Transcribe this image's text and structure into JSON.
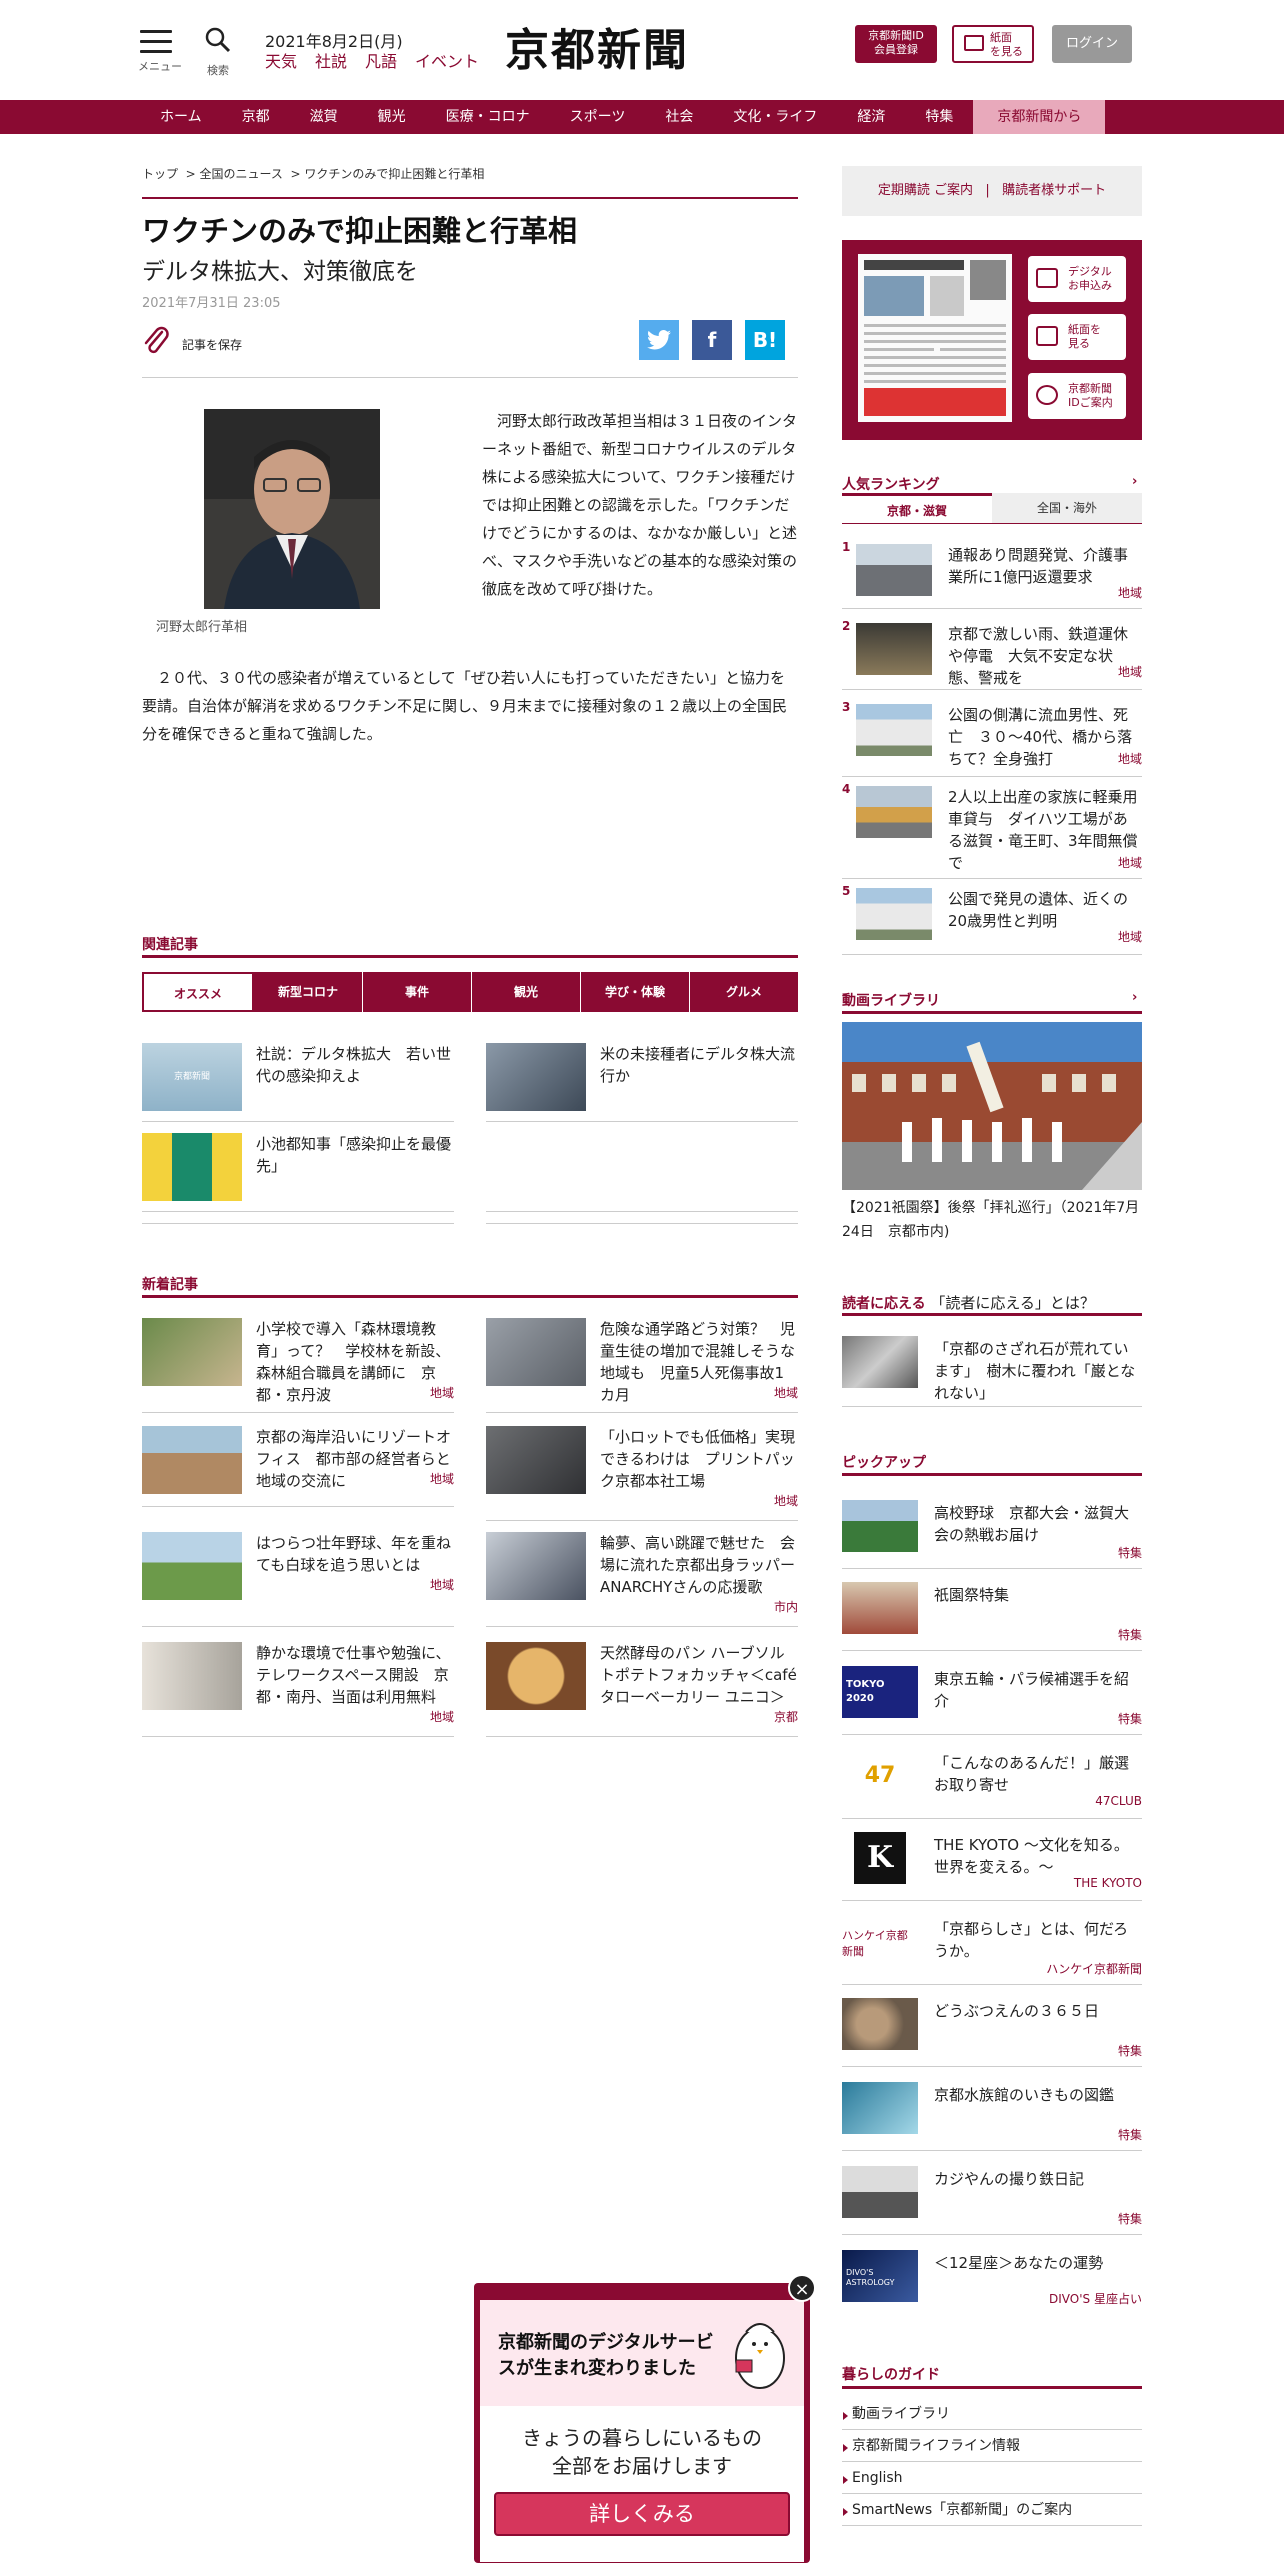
{
  "header": {
    "menu_label": "メニュー",
    "search_label": "検索",
    "date": "2021年8月2日(月)",
    "links": [
      "天気",
      "社説",
      "凡語",
      "イベント"
    ],
    "logo": "京都新聞",
    "id_btn_line1": "京都新聞ID",
    "id_btn_line2": "会員登録",
    "paper_btn_line1": "紙面",
    "paper_btn_line2": "を見る",
    "login": "ログイン"
  },
  "nav": [
    "ホーム",
    "京都",
    "滋賀",
    "観光",
    "医療・コロナ",
    "スポーツ",
    "社会",
    "文化・ライフ",
    "経済",
    "特集",
    "京都新聞から"
  ],
  "article": {
    "breadcrumb": [
      "トップ",
      "全国のニュース",
      "ワクチンのみで抑止困難と行革相"
    ],
    "title": "ワクチンのみで抑止困難と行革相",
    "subtitle": "デルタ株拡大、対策徹底を",
    "date": "2021年7月31日 23:05",
    "save_label": "記事を保存",
    "photo_caption": "河野太郎行革相",
    "para1": "　河野太郎行政改革担当相は３１日夜のインターネット番組で、新型コロナウイルスのデルタ株による感染拡大について、ワクチン接種だけでは抑止困難との認識を示した。「ワクチンだけでどうにかするのは、なかなか厳しい」と述べ、マスクや手洗いなどの基本的な感染対策の徹底を改めて呼び掛けた。",
    "para2": "　２０代、３０代の感染者が増えているとして「ぜひ若い人にも打っていただきたい」と協力を要請。自治体が解消を求めるワクチン不足に関し、９月末までに接種対象の１２歳以上の全国民分を確保できると重ねて強調した。"
  },
  "related": {
    "title": "関連記事",
    "tabs": [
      "オススメ",
      "新型コロナ",
      "事件",
      "観光",
      "学び・体験",
      "グルメ"
    ],
    "items": [
      {
        "text": "社説：デルタ株拡大　若い世代の感染抑えよ",
        "thumb_text": "京都新聞"
      },
      {
        "text": "米の未接種者にデルタ株大流行か"
      },
      {
        "text": "小池都知事「感染抑止を最優先」"
      }
    ]
  },
  "latest": {
    "title": "新着記事",
    "items": [
      {
        "text": "小学校で導入「森林環境教育」って？　学校林を新設、森林組合職員を講師に　京都・京丹波",
        "tag": "地域"
      },
      {
        "text": "危険な通学路どう対策？　児童生徒の増加で混雑しそうな地域も　児童5人死傷事故1カ月",
        "tag": "地域"
      },
      {
        "text": "京都の海岸沿いにリゾートオフィス　都市部の経営者らと地域の交流に",
        "tag": "地域"
      },
      {
        "text": "「小ロットでも低価格」実現できるわけは　プリントパック京都本社工場",
        "tag": "地域"
      },
      {
        "text": "はつらつ壮年野球、年を重ねても白球を追う思いとは",
        "tag": "地域"
      },
      {
        "text": "輪夢、高い跳躍で魅せた　会場に流れた京都出身ラッパーANARCHYさんの応援歌",
        "tag": "市内"
      },
      {
        "text": "静かな環境で仕事や勉強に、テレワークスペース開設　京都・南丹、当面は利用無料",
        "tag": "地域"
      },
      {
        "text": "天然酵母のパン ハーブソルトポテトフォカッチャ＜café タローベーカリー ユニコ＞",
        "tag": "京都"
      }
    ]
  },
  "sidebar": {
    "subscribe": "定期購読 ご案内",
    "support": "購読者様サポート",
    "paper_buttons": [
      {
        "l1": "デジタル",
        "l2": "お申込み"
      },
      {
        "l1": "紙面を",
        "l2": "見る"
      },
      {
        "l1": "京都新聞",
        "l2": "IDご案内"
      }
    ],
    "ranking_title": "人気ランキング",
    "ranking_tabs": [
      "京都・滋賀",
      "全国・海外"
    ],
    "ranking": [
      {
        "no": "1",
        "text": "通報あり問題発覚、介護事業所に1億円返還要求",
        "tag": "地域"
      },
      {
        "no": "2",
        "text": "京都で激しい雨、鉄道運休や停電　大気不安定な状態、警戒を",
        "tag": "地域"
      },
      {
        "no": "3",
        "text": "公園の側溝に流血男性、死亡　３０～40代、橋から落ちて？全身強打",
        "tag": "地域"
      },
      {
        "no": "4",
        "text": "2人以上出産の家族に軽乗用車貸与　ダイハツ工場がある滋賀・竜王町、3年間無償で",
        "tag": "地域"
      },
      {
        "no": "5",
        "text": "公園で発見の遺体、近くの20歳男性と判明",
        "tag": "地域"
      }
    ],
    "video_title": "動画ライブラリ",
    "video_caption": "【2021祇園祭】後祭「拝礼巡行」（2021年7月24日　京都市内)",
    "readers_title": "読者に応える",
    "readers_sub": "「読者に応える」とは？",
    "readers_item": "「京都のさざれ石が荒れています」　樹木に覆われ「巌となれない」",
    "pickup_title": "ピックアップ",
    "pickup": [
      {
        "text": "高校野球　京都大会・滋賀大会の熱戦お届け",
        "tag": "特集"
      },
      {
        "text": "祇園祭特集",
        "tag": "特集"
      },
      {
        "text": "東京五輪・パラ候補選手を紹介",
        "tag": "特集",
        "thumb_text": "TOKYO 2020"
      },
      {
        "text": "「こんなのあるんだ！」厳選お取り寄せ",
        "tag": "47CLUB",
        "thumb_text": "47"
      },
      {
        "text": "THE KYOTO ～文化を知る。世界を変える。～",
        "tag": "THE KYOTO",
        "thumb_text": "K"
      },
      {
        "text": "「京都らしさ」とは、何だろうか。",
        "tag": "ハンケイ京都新聞",
        "thumb_text": "ハンケイ京都新聞"
      },
      {
        "text": "どうぶつえんの３６５日",
        "tag": "特集"
      },
      {
        "text": "京都水族館のいきもの図鑑",
        "tag": "特集"
      },
      {
        "text": "カジやんの撮り鉄日記",
        "tag": "特集"
      },
      {
        "text": "＜12星座＞あなたの運勢",
        "tag": "DIVO'S 星座占い",
        "thumb_text": "DIVO'S ASTROLOGY"
      }
    ],
    "guide_title": "暮らしのガイド",
    "guide": [
      "動画ライブラリ",
      "京都新聞ライフライン情報",
      "English",
      "SmartNews「京都新聞」のご案内"
    ]
  },
  "popup": {
    "head": "京都新聞のデジタルサービスが生まれ変わりました",
    "body_l1": "きょうの暮らしにいるもの",
    "body_l2": "全部をお届けします",
    "button": "詳しくみる",
    "close": "×"
  },
  "colors": {
    "brand": "#8a0a32",
    "accent_pink": "#e8a9bb",
    "popup_button": "#d6365c"
  }
}
